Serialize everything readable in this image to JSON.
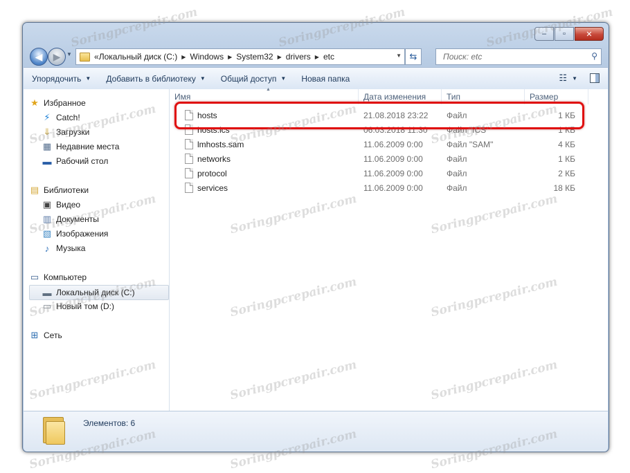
{
  "window": {
    "caption_buttons": {
      "minimize": "–",
      "maximize": "▫",
      "close": "✕"
    }
  },
  "address": {
    "crumbs": [
      "Локальный диск (C:)",
      "Windows",
      "System32",
      "drivers",
      "etc"
    ],
    "search_placeholder": "Поиск: etc"
  },
  "toolbar": {
    "organize": "Упорядочить",
    "add_to_library": "Добавить в библиотеку",
    "share": "Общий доступ",
    "new_folder": "Новая папка"
  },
  "nav": {
    "favorites": {
      "label": "Избранное",
      "items": [
        "Catch!",
        "Загрузки",
        "Недавние места",
        "Рабочий стол"
      ]
    },
    "libraries": {
      "label": "Библиотеки",
      "items": [
        "Видео",
        "Документы",
        "Изображения",
        "Музыка"
      ]
    },
    "computer": {
      "label": "Компьютер",
      "items": [
        "Локальный диск (C:)",
        "Новый том (D:)"
      ]
    },
    "network": {
      "label": "Сеть"
    }
  },
  "columns": {
    "name": "Имя",
    "date": "Дата изменения",
    "type": "Тип",
    "size": "Размер"
  },
  "files": [
    {
      "name": "hosts",
      "date": "21.08.2018 23:22",
      "type": "Файл",
      "size": "1 КБ"
    },
    {
      "name": "hosts.ics",
      "date": "06.03.2018 11:30",
      "type": "Файл \"ICS\"",
      "size": "1 КБ"
    },
    {
      "name": "lmhosts.sam",
      "date": "11.06.2009 0:00",
      "type": "Файл \"SAM\"",
      "size": "4 КБ"
    },
    {
      "name": "networks",
      "date": "11.06.2009 0:00",
      "type": "Файл",
      "size": "1 КБ"
    },
    {
      "name": "protocol",
      "date": "11.06.2009 0:00",
      "type": "Файл",
      "size": "2 КБ"
    },
    {
      "name": "services",
      "date": "11.06.2009 0:00",
      "type": "Файл",
      "size": "18 КБ"
    }
  ],
  "status": {
    "count": "Элементов: 6"
  },
  "watermark": "Soringpcrepair.com",
  "colors": {
    "highlight": "#e01010",
    "accent": "#1e395b"
  }
}
